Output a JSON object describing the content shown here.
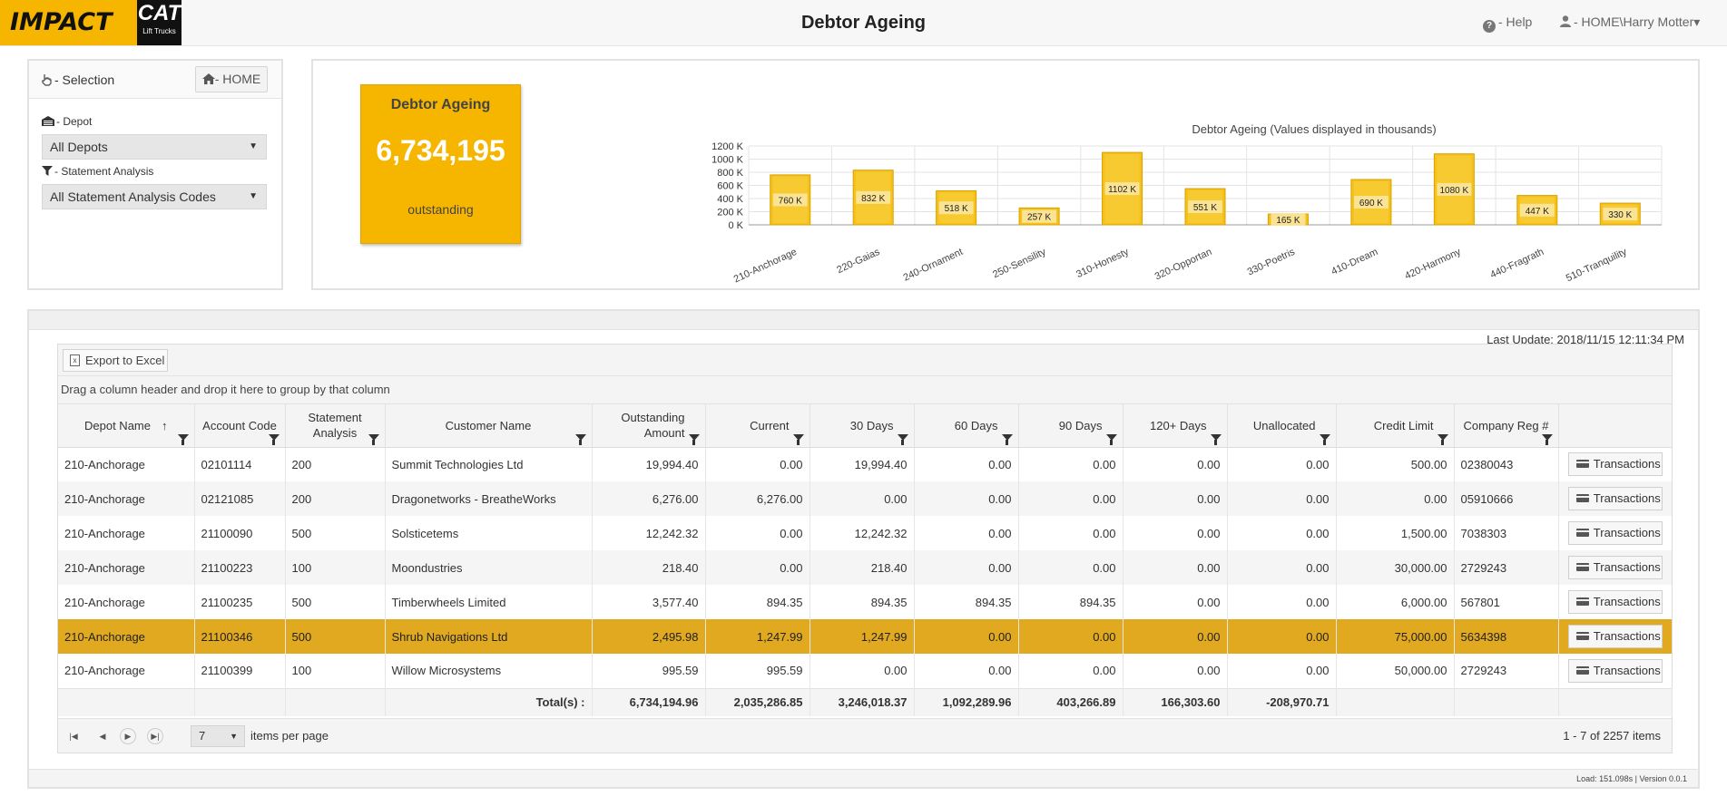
{
  "header": {
    "logo_text": "IMPACT",
    "cat_text": "CAT",
    "cat_sub": "Lift Trucks",
    "title": "Debtor Ageing",
    "help": "- Help",
    "user": "- HOME\\Harry Motter",
    "user_caret": "▾",
    "help_icon": "question-circle-icon",
    "user_icon": "user-icon"
  },
  "selection": {
    "title": "- Selection",
    "home_label": "- HOME",
    "depot_label": "- Depot",
    "depot_value": "All Depots",
    "analysis_label": "- Statement Analysis",
    "analysis_value": "All Statement Analysis Codes"
  },
  "kpi": {
    "title": "Debtor Ageing",
    "value": "6,734,195",
    "label": "outstanding",
    "color": "#f6b600"
  },
  "chart_data": {
    "type": "bar",
    "title": "Debtor Ageing (Values displayed in thousands)",
    "categories": [
      "210-Anchorage",
      "220-Gaias",
      "240-Ornament",
      "250-Sensility",
      "310-Honesty",
      "320-Opportan",
      "330-Poetris",
      "410-Dream",
      "420-Harmony",
      "440-Fragrath",
      "510-Tranquility"
    ],
    "values": [
      760,
      832,
      518,
      257,
      1102,
      551,
      165,
      690,
      1080,
      447,
      330
    ],
    "data_labels": [
      "760 K",
      "832 K",
      "518 K",
      "257 K",
      "1102 K",
      "551 K",
      "165 K",
      "690 K",
      "1080 K",
      "447 K",
      "330 K"
    ],
    "yticks": [
      "0 K",
      "200 K",
      "400 K",
      "600 K",
      "800 K",
      "1000 K",
      "1200 K"
    ],
    "ylim": [
      0,
      1200
    ],
    "grid": true,
    "bar_color": "#f6c21a"
  },
  "grid": {
    "last_update": "Last Update: 2018/11/15 12:11:34 PM",
    "export_label": "Export to Excel",
    "group_hint": "Drag a column header and drop it here to group by that column",
    "columns": [
      {
        "label": "Depot Name",
        "sort": "↑"
      },
      {
        "label": "Account Code"
      },
      {
        "label": "Statement Analysis"
      },
      {
        "label": "Customer Name"
      },
      {
        "label": "Outstanding Amount"
      },
      {
        "label": "Current"
      },
      {
        "label": "30 Days"
      },
      {
        "label": "60 Days"
      },
      {
        "label": "90 Days"
      },
      {
        "label": "120+ Days"
      },
      {
        "label": "Unallocated"
      },
      {
        "label": "Credit Limit"
      },
      {
        "label": "Company Reg #"
      }
    ],
    "rows": [
      [
        "210-Anchorage",
        "02101114",
        "200",
        "Summit Technologies Ltd",
        "19,994.40",
        "0.00",
        "19,994.40",
        "0.00",
        "0.00",
        "0.00",
        "0.00",
        "500.00",
        "02380043"
      ],
      [
        "210-Anchorage",
        "02121085",
        "200",
        "Dragonetworks - BreatheWorks",
        "6,276.00",
        "6,276.00",
        "0.00",
        "0.00",
        "0.00",
        "0.00",
        "0.00",
        "0.00",
        "05910666"
      ],
      [
        "210-Anchorage",
        "21100090",
        "500",
        "Solsticetems",
        "12,242.32",
        "0.00",
        "12,242.32",
        "0.00",
        "0.00",
        "0.00",
        "0.00",
        "1,500.00",
        "7038303"
      ],
      [
        "210-Anchorage",
        "21100223",
        "100",
        "Moondustries",
        "218.40",
        "0.00",
        "218.40",
        "0.00",
        "0.00",
        "0.00",
        "0.00",
        "30,000.00",
        "2729243"
      ],
      [
        "210-Anchorage",
        "21100235",
        "500",
        "Timberwheels Limited",
        "3,577.40",
        "894.35",
        "894.35",
        "894.35",
        "894.35",
        "0.00",
        "0.00",
        "6,000.00",
        "567801"
      ],
      [
        "210-Anchorage",
        "21100346",
        "500",
        "Shrub Navigations Ltd",
        "2,495.98",
        "1,247.99",
        "1,247.99",
        "0.00",
        "0.00",
        "0.00",
        "0.00",
        "75,000.00",
        "5634398"
      ],
      [
        "210-Anchorage",
        "21100399",
        "100",
        "Willow Microsystems",
        "995.59",
        "995.59",
        "0.00",
        "0.00",
        "0.00",
        "0.00",
        "0.00",
        "50,000.00",
        "2729243"
      ]
    ],
    "selected_row": 5,
    "transactions_label": "Transactions",
    "totals_label": "Total(s) :",
    "totals": [
      "6,734,194.96",
      "2,035,286.85",
      "3,246,018.37",
      "1,092,289.96",
      "403,266.89",
      "166,303.60",
      "-208,970.71"
    ],
    "page_size": "7",
    "items_per_page": "items per page",
    "count": "1 - 7 of 2257 items"
  },
  "footer": {
    "load": "Load: 151.098s | Version 0.0.1"
  }
}
